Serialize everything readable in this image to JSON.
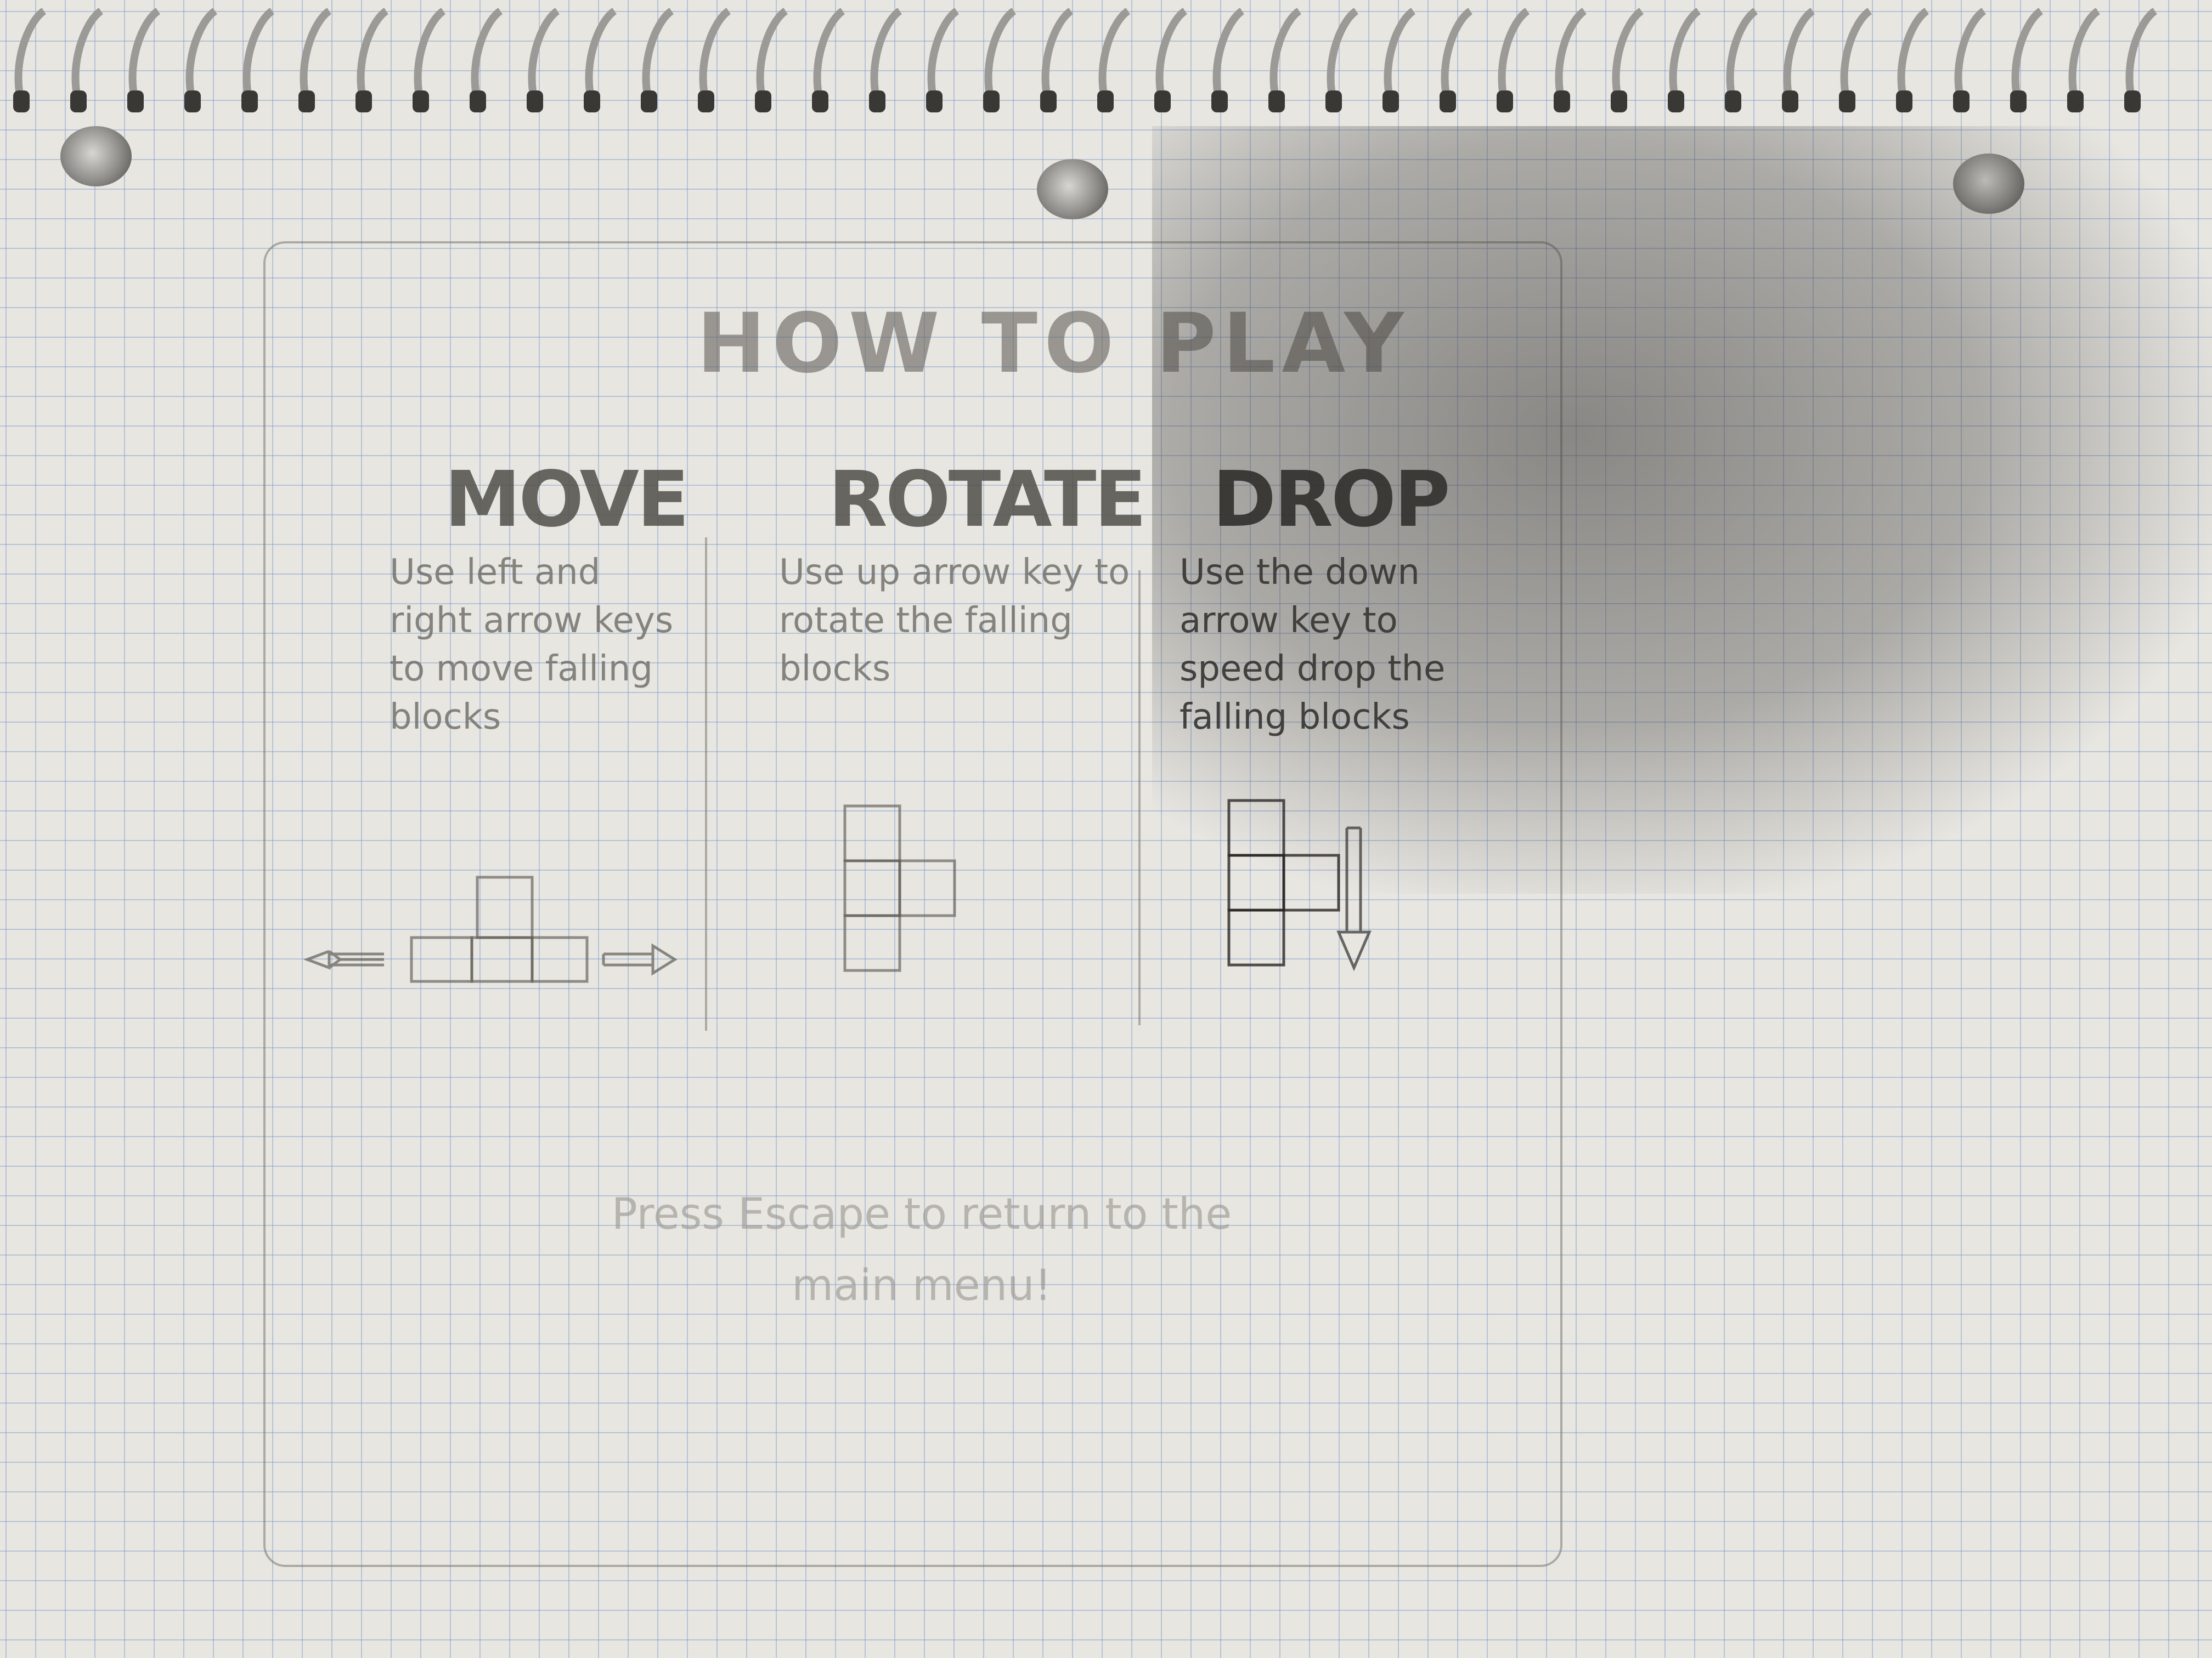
{
  "screen": {
    "title": "HOW TO PLAY",
    "footer": "Press Escape to return to the main menu!"
  },
  "sections": [
    {
      "heading": "MOVE",
      "description": "Use left and right arrow keys to move falling blocks"
    },
    {
      "heading": "ROTATE",
      "description": "Use up arrow key to rotate the falling blocks"
    },
    {
      "heading": "DROP",
      "description": "Use the down arrow key to speed drop the falling blocks"
    }
  ],
  "icons": {
    "move": [
      "left-arrow-icon",
      "right-arrow-icon",
      "block-piece-icon"
    ],
    "rotate": [
      "block-piece-icon"
    ],
    "drop": [
      "block-piece-icon",
      "down-arrow-icon"
    ]
  },
  "colors": {
    "paper": "#e8e6e1",
    "grid": "#7896c8",
    "pencil": "#5f5c56"
  }
}
